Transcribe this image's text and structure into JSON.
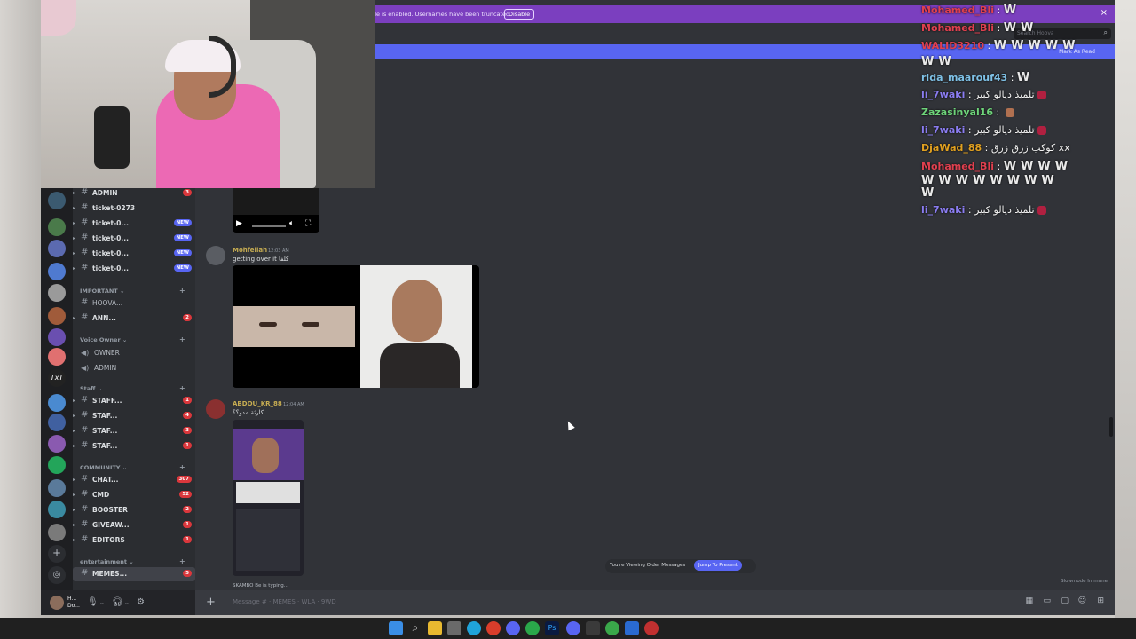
{
  "banner": {
    "streamer_text": "Streamer Mode is enabled. Usernames have been truncated.",
    "disable_label": "Disable",
    "search_placeholder": "Search Hoova",
    "mark_read": "Mark As Read"
  },
  "channels": {
    "items": [
      {
        "name": "ADMIN",
        "badge": "3"
      },
      {
        "name": "ticket-0273",
        "badge": ""
      },
      {
        "name": "ticket-0...",
        "badge": "NEW"
      },
      {
        "name": "ticket-0...",
        "badge": "NEW"
      },
      {
        "name": "ticket-0...",
        "badge": "NEW"
      },
      {
        "name": "ticket-0...",
        "badge": "NEW"
      }
    ],
    "cat_important": "IMPORTANT",
    "important_items": [
      {
        "name": "HOOVA...",
        "badge": ""
      },
      {
        "name": "ANN...",
        "badge": "2"
      }
    ],
    "cat_voice": "Voice Owner",
    "voice_items": [
      {
        "name": "OWNER"
      },
      {
        "name": "ADMIN"
      }
    ],
    "cat_staff": "Staff",
    "staff_items": [
      {
        "name": "STAFF...",
        "badge": "1"
      },
      {
        "name": "STAF...",
        "badge": "4"
      },
      {
        "name": "STAF...",
        "badge": "3"
      },
      {
        "name": "STAF...",
        "badge": "1"
      }
    ],
    "cat_community": "COMMUNITY",
    "community_items": [
      {
        "name": "CHAT...",
        "badge": "307"
      },
      {
        "name": "CMD",
        "badge": "52"
      },
      {
        "name": "BOOSTER",
        "badge": "2"
      },
      {
        "name": "GIVEAW...",
        "badge": "1"
      },
      {
        "name": "EDITORS",
        "badge": "1"
      }
    ],
    "cat_entertainment": "entertainment",
    "entertainment_items": [
      {
        "name": "MEMES...",
        "badge": "5"
      }
    ]
  },
  "user": {
    "name": "H... Do..."
  },
  "messages": [
    {
      "author": "Mohfellah",
      "time": "12:03 AM",
      "text": "getting over it كلفا",
      "author_color": "#c7ad52"
    },
    {
      "author": "ABDOU_KR_88",
      "time": "12:04 AM",
      "text": "كارثة مدو؟؟",
      "author_color": "#c7ad52"
    }
  ],
  "typing": "SKAMBO Be is typing...",
  "jump": {
    "text": "You're Viewing Older Messages",
    "button": "Jump To Present"
  },
  "slowmode": "Slowmode Immune",
  "composer": {
    "placeholder": "Message # · MEMES · WLA · 9WD"
  },
  "overlay": {
    "lines": [
      {
        "user": "Mohamed_Bli",
        "color": "#e0404f",
        "msg": "",
        "ws": 1
      },
      {
        "user": "Mohamed_Bli",
        "color": "#e0404f",
        "msg": "",
        "ws": 2
      },
      {
        "user": "WALID3210",
        "color": "#e0404f",
        "msg": "",
        "ws": 5
      },
      {
        "user": "",
        "color": "#e0404f",
        "msg": "",
        "ws": 2
      },
      {
        "user": "rida_maarouf43",
        "color": "#7fc1e6",
        "msg": "",
        "ws": 1
      },
      {
        "user": "li_7waki",
        "color": "#8a7cf0",
        "msg": "تلميذ ديالو كبير",
        "ws": 0
      },
      {
        "user": "Zazasinyal16",
        "color": "#6ed47a",
        "msg": "",
        "ws": 0
      },
      {
        "user": "li_7waki",
        "color": "#8a7cf0",
        "msg": "تلميذ ديالو كبير",
        "ws": 0
      },
      {
        "user": "DjaWad_88",
        "color": "#e0a020",
        "msg": "كوكب زرق زرق xx",
        "ws": 0
      },
      {
        "user": "Mohamed_Bli",
        "color": "#e0404f",
        "msg": "",
        "ws": 4
      },
      {
        "user": "",
        "color": "#e0404f",
        "msg": "",
        "ws": 8
      },
      {
        "user": "",
        "color": "#e0404f",
        "msg": "",
        "ws": 1
      },
      {
        "user": "li_7waki",
        "color": "#8a7cf0",
        "msg": "تلميذ ديالو كبير",
        "ws": 0
      }
    ]
  }
}
